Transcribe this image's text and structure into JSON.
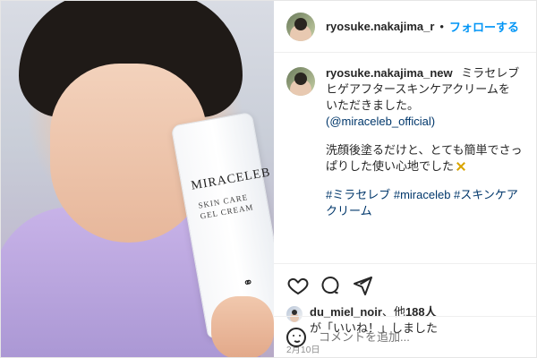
{
  "post": {
    "username": "ryosuke.nakajima_r",
    "follow_label": "フォローする",
    "dot": "•",
    "caption": {
      "username": "ryosuke.nakajima_new",
      "line1": "ミラセレブ ヒゲアフタースキンケアクリームを いただきました。",
      "mention": "(@miraceleb_official)",
      "line2": "洗顔後塗るだけと、とても簡単でさっぱりした使い心地でした",
      "hashtags": "#ミラセレブ #miraceleb #スキンケアクリーム"
    },
    "likes": {
      "user": "du_miel_noir",
      "text_middle": "、他",
      "count": "188人",
      "text_end": "が「いいね！」しました"
    },
    "date": "2月10日",
    "comment_placeholder": "コメントを追加..."
  },
  "photo": {
    "brand": "MIRACELEB",
    "sub1": "SKIN CARE",
    "sub2": "GEL CREAM",
    "mark": "⚭"
  }
}
